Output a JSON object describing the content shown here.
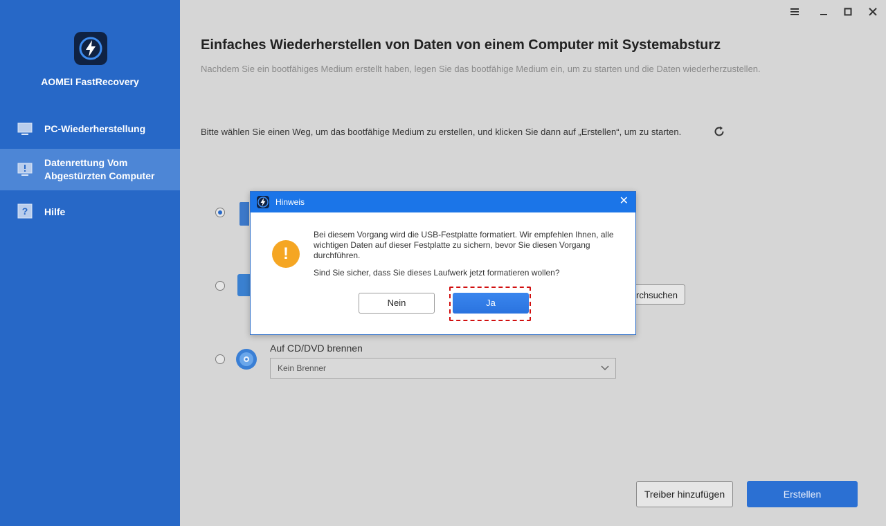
{
  "app": {
    "name": "AOMEI FastRecovery"
  },
  "sidebar": {
    "items": [
      {
        "label": "PC-Wiederherstellung"
      },
      {
        "label_line1": "Datenrettung Vom",
        "label_line2": "Abgestürzten Computer",
        "active": true
      },
      {
        "label": "Hilfe"
      }
    ]
  },
  "window_controls": {
    "menu": "menu-icon",
    "minimize": "minimize-icon",
    "maximize": "maximize-icon",
    "close": "close-icon"
  },
  "main": {
    "title": "Einfaches Wiederherstellen von Daten von einem Computer mit Systemabsturz",
    "subtitle": "Nachdem Sie ein bootfähiges Medium erstellt haben, legen Sie das bootfähige Medium ein, um zu starten und die Daten wiederherzustellen.",
    "instruction": "Bitte wählen Sie einen Weg, um das bootfähige Medium zu erstellen, und klicken Sie dann auf „Erstellen“, um zu starten.",
    "options": [
      {
        "selected": true
      },
      {
        "selected": false,
        "browse_label": "urchsuchen"
      },
      {
        "selected": false,
        "label": "Auf CD/DVD brennen",
        "select_value": "Kein Brenner"
      }
    ],
    "add_driver_label": "Treiber hinzufügen",
    "create_label": "Erstellen"
  },
  "dialog": {
    "title": "Hinweis",
    "message1": "Bei diesem Vorgang wird die USB-Festplatte formatiert. Wir empfehlen Ihnen, alle wichtigen Daten auf dieser Festplatte zu sichern, bevor Sie diesen Vorgang durchführen.",
    "message2": "Sind Sie sicher, dass Sie dieses Laufwerk jetzt formatieren wollen?",
    "warning_glyph": "!",
    "close_glyph": "✕",
    "no_label": "Nein",
    "yes_label": "Ja"
  },
  "colors": {
    "sidebar": "#2768c7",
    "sidebar_active": "#4d86d6",
    "dialog_titlebar": "#1b75e8",
    "warning": "#f5a623",
    "highlight": "#d10f0f"
  }
}
